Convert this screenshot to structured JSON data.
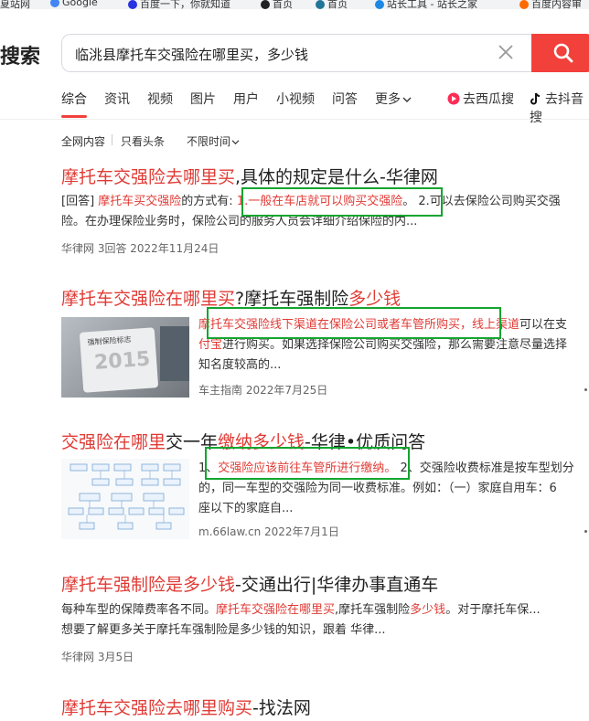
{
  "bookmarks": [
    "夏站网",
    "Google",
    "百度一下，你就知道",
    "首页",
    "首页",
    "站长工具 - 站长之家",
    "百度内容审"
  ],
  "logo": "搜索",
  "search": {
    "query": "临洮县摩托车交强险在哪里买，多少钱"
  },
  "tabs": [
    "综合",
    "资讯",
    "视频",
    "图片",
    "用户",
    "小视频",
    "问答",
    "更多"
  ],
  "tabs_extra": [
    "去西瓜搜",
    "去抖音搜"
  ],
  "filters": [
    "全网内容",
    "只看头条",
    "不限时间"
  ],
  "results": [
    {
      "title_hl": "摩托车交强险去哪里买",
      "title_rest": ",具体的规定是什么-华律网",
      "snip1_a": "[回答] ",
      "snip1_hl": "摩托车买交强险",
      "snip1_b": "的方式有: ",
      "snip1_box": "1.一般在车店就可以购买交强险",
      "snip1_c": "。 2.可以去保险公司购买交强",
      "snip2": "险。在办理保险业务时，保险公司的服务人员会详细介绍保险的内...",
      "meta": "华律网  3回答  2022年11月24日"
    },
    {
      "title_hl": "摩托车交强险在哪里买",
      "title_mid": "?摩托车强制险",
      "title_hl2": "多少钱",
      "box": "摩托车交强险线下渠道在保险公司或者车管所购买，线上渠道",
      "box_after": "可以在支",
      "line2_hl": "付宝",
      "line2": "进行购买。如果选择保险公司购买交强险，那么需要注意尽量选择",
      "line3": "知名度较高的...",
      "meta": "车主指南  2022年7月25日",
      "thumb_text": [
        "强制保险标志",
        "2015"
      ]
    },
    {
      "title_hl": "交强险在哪里",
      "title_mid": "交一年",
      "title_hl2": "缴纳多少钱",
      "title_rest": "-华律•优质问答",
      "pre": "1、",
      "box": "交强险应该前往车管所进行缴纳。",
      "after": "2、交强险收费标准是按车型划分",
      "line2": "的，同一车型的交强险为同一收费标准。例如：（一）家庭自用车：6",
      "line3": "座以下的家庭自...",
      "meta": "m.66law.cn  2022年7月1日"
    },
    {
      "title_hl": "摩托车强制险是多少钱",
      "title_rest": "-交通出行|华律办事直通车",
      "snip1": "每种车型的保障费率各不同。",
      "snip1_hl": "摩托车交强险在哪里买",
      "snip1_b": ",摩托车强制险",
      "snip1_hl2": "多少钱",
      "snip1_c": "。对于摩托车保...",
      "snip2": "想要了解更多关于摩托车强制险是多少钱的知识，跟着 华律...",
      "meta": "华律网  3月5日"
    },
    {
      "title_hl": "摩托车交强险去哪里购买",
      "title_rest": "-找法网"
    }
  ],
  "colors": {
    "accent": "#f2403b",
    "highlight": "#e03b35",
    "annotation_box": "#13a52e"
  }
}
